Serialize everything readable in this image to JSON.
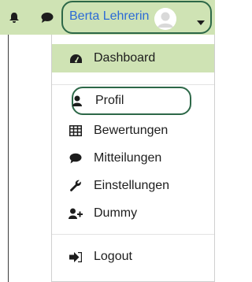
{
  "topbar": {
    "icons": [
      "bell-icon",
      "speech-bubble-icon"
    ],
    "user_name": "Berta Lehrerin",
    "avatar": "avatar-icon",
    "caret": "caret-down-icon",
    "colors": {
      "bar_bg": "#cfe3b4",
      "outline": "#2d6848",
      "user_text": "#2c6bd6"
    }
  },
  "menu": {
    "items": [
      {
        "label": "Dashboard",
        "icon": "dashboard-icon"
      },
      {
        "label": "Profil",
        "icon": "user-icon"
      },
      {
        "label": "Bewertungen",
        "icon": "table-icon"
      },
      {
        "label": "Mitteilungen",
        "icon": "speech-bubble-icon"
      },
      {
        "label": "Einstellungen",
        "icon": "wrench-icon"
      },
      {
        "label": "Dummy",
        "icon": "user-plus-icon"
      },
      {
        "label": "Logout",
        "icon": "sign-out-icon"
      }
    ]
  }
}
